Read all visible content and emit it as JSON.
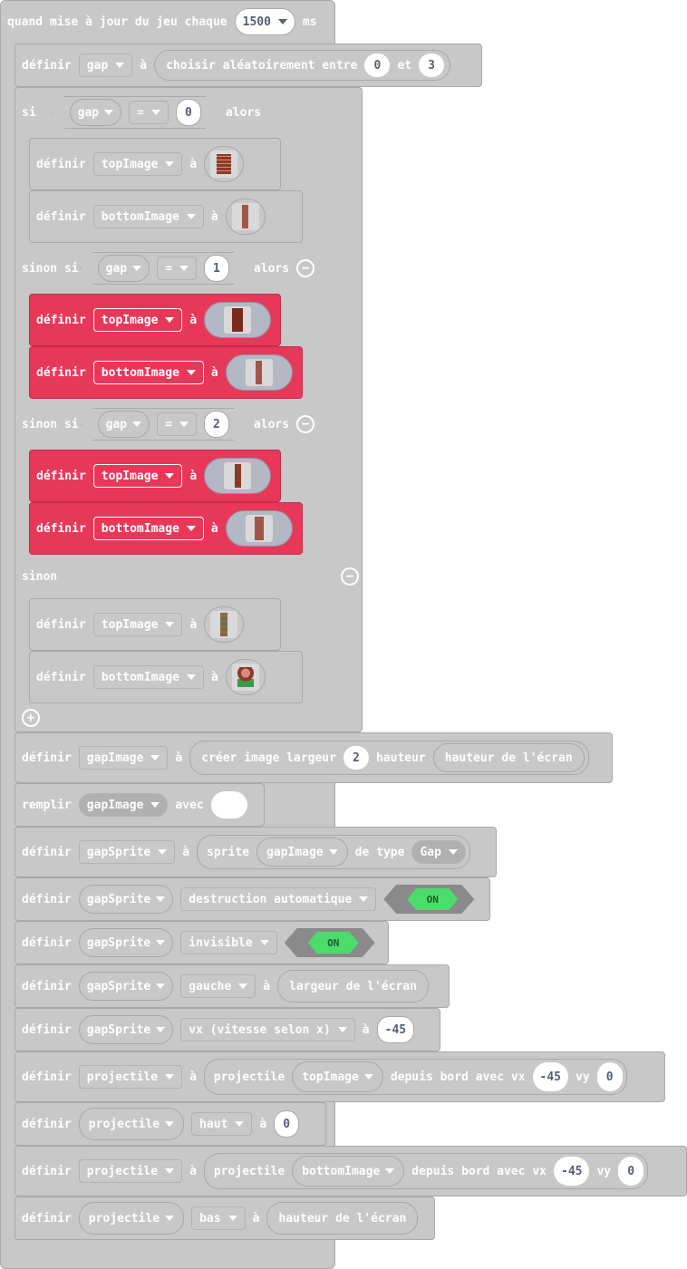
{
  "colors": {
    "block_grey": "#c8c8c8",
    "block_red": "#e8385a",
    "toggle_on": "#4cdc6c"
  },
  "event": {
    "label": "quand mise à jour du jeu chaque",
    "interval": "1500",
    "unit": "ms"
  },
  "common": {
    "definir": "définir",
    "a": "à",
    "alors": "alors",
    "eq": "=",
    "avec": "avec"
  },
  "gap_set": {
    "var": "gap",
    "fn": "choisir aléatoirement entre",
    "from": "0",
    "et": "et",
    "to": "3"
  },
  "if": {
    "si": "si",
    "sinon_si": "sinon si",
    "sinon": "sinon",
    "var": "gap",
    "v0": "0",
    "v1": "1",
    "v2": "2"
  },
  "vars": {
    "top": "topImage",
    "bottom": "bottomImage",
    "gapImage": "gapImage",
    "gapSprite": "gapSprite",
    "projectile": "projectile"
  },
  "create": {
    "fn": "créer image largeur",
    "w": "2",
    "h_label": "hauteur",
    "h_val": "hauteur de l'écran"
  },
  "fill": {
    "label": "remplir",
    "avec": "avec"
  },
  "sprite": {
    "label": "sprite",
    "type_label": "de type",
    "type": "Gap"
  },
  "props": {
    "auto": "destruction automatique",
    "invisible": "invisible",
    "on": "ON",
    "gauche": "gauche",
    "largeur": "largeur de l'écran",
    "vx": "vx (vitesse selon x)",
    "vxval": "-45",
    "haut": "haut",
    "zero": "0",
    "bas": "bas",
    "hauteur": "hauteur de l'écran"
  },
  "proj": {
    "label": "projectile",
    "fn": "depuis bord avec vx",
    "vx": "-45",
    "vy_label": "vy",
    "vy": "0"
  },
  "icons": {
    "minus": "minus-circle-icon",
    "plus": "plus-circle-icon"
  }
}
